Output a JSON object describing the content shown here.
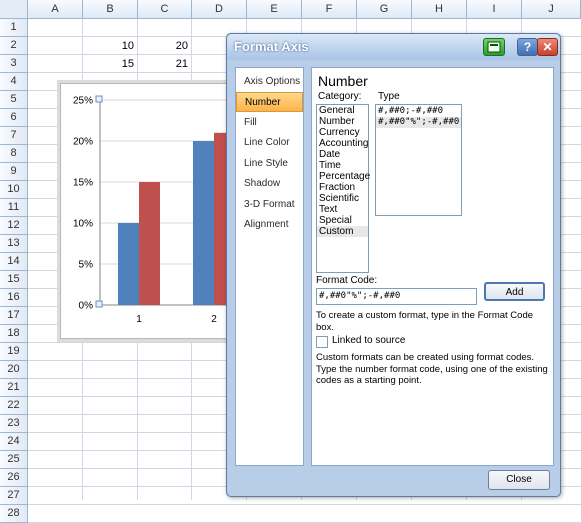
{
  "spreadsheet": {
    "columns": [
      "A",
      "B",
      "C",
      "D",
      "E",
      "F",
      "G",
      "H",
      "I",
      "J"
    ],
    "rows": [
      "1",
      "2",
      "3",
      "4",
      "5",
      "6",
      "7",
      "8",
      "9",
      "10",
      "11",
      "12",
      "13",
      "14",
      "15",
      "16",
      "17",
      "18",
      "19",
      "20",
      "21",
      "22",
      "23",
      "24",
      "25",
      "26",
      "27",
      "28"
    ],
    "cells": {
      "b2": "10",
      "c2": "20",
      "b3": "15",
      "c3": "21"
    }
  },
  "chart": {
    "y_ticks": [
      "25%",
      "20%",
      "15%",
      "10%",
      "5%",
      "0%"
    ],
    "x_ticks": [
      "1",
      "2"
    ]
  },
  "chart_data": {
    "type": "bar",
    "categories": [
      "1",
      "2"
    ],
    "series": [
      {
        "values": [
          10,
          20
        ],
        "color": "#4f81bd"
      },
      {
        "values": [
          15,
          21
        ],
        "color": "#c0504d"
      }
    ],
    "ylim": [
      0,
      25
    ],
    "y_tick_values": [
      0,
      5,
      10,
      15,
      20,
      25
    ],
    "y_format": "percent",
    "xlabel": "",
    "ylabel": "",
    "grid": true
  },
  "dialog": {
    "title": "Format Axis",
    "help_label": "?",
    "close_glyph": "✕",
    "nav": [
      "Axis Options",
      "Number",
      "Fill",
      "Line Color",
      "Line Style",
      "Shadow",
      "3-D Format",
      "Alignment"
    ],
    "selected_nav": "Number",
    "section_title": "Number",
    "category_label": "Category:",
    "categories": [
      "General",
      "Number",
      "Currency",
      "Accounting",
      "Date",
      "Time",
      "Percentage",
      "Fraction",
      "Scientific",
      "Text",
      "Special",
      "Custom"
    ],
    "selected_category": "Custom",
    "type_label": "Type",
    "types": [
      "#,##0;-#,##0",
      "#,##0\"%\";-#,##0"
    ],
    "format_code_label": "Format Code:",
    "format_code_value": "#,##0\"%\";-#,##0",
    "add_label": "Add",
    "help_line1": "To create a custom format, type in the Format Code box.",
    "linked_label": "Linked to source",
    "linked_checked": false,
    "help_line2": "Custom formats can be created using format codes. Type the number format code, using one of the existing codes as a starting point.",
    "close_label": "Close"
  },
  "colors": {
    "accent_selected": "#ffc25e",
    "series1": "#4f81bd",
    "series2": "#c0504d"
  }
}
